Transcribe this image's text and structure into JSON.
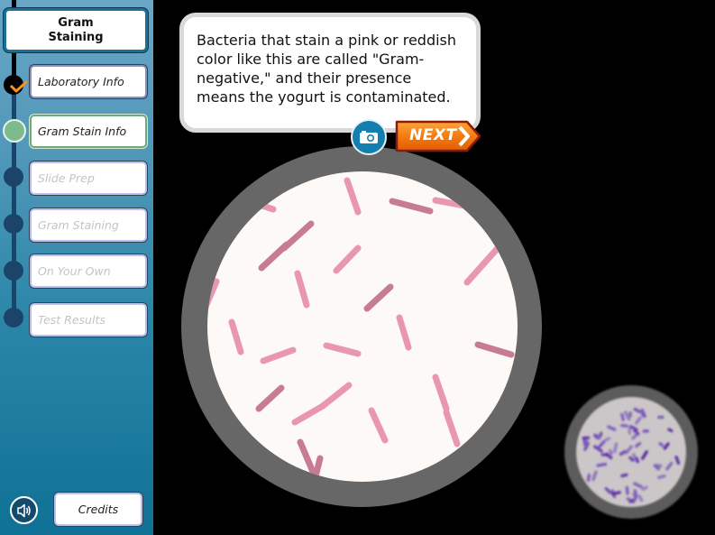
{
  "sidebar": {
    "title": "Gram\nStaining",
    "items": [
      {
        "label": "Laboratory Info",
        "state": "done"
      },
      {
        "label": "Gram Stain Info",
        "state": "current"
      },
      {
        "label": "Slide Prep",
        "state": "locked"
      },
      {
        "label": "Gram Staining",
        "state": "locked"
      },
      {
        "label": "On Your Own",
        "state": "locked"
      },
      {
        "label": "Test Results",
        "state": "locked"
      }
    ],
    "credits_label": "Credits",
    "sound_icon": "speaker-icon"
  },
  "dialog": {
    "text": "Bacteria that stain a pink or reddish color like this are called \"Gram-negative,\" and their presence means the yogurt is contaminated.",
    "camera_icon": "camera-icon",
    "next_label": "NEXT"
  },
  "colors": {
    "gram_negative_light": "#e996b2",
    "gram_negative_dark": "#c87b95",
    "slide_background": "#fdf9f6",
    "lens_ring": "#676767",
    "gram_positive": "#5b2fa6",
    "next_orange": "#f2700a",
    "accent_blue": "#137fae"
  },
  "microscope_view": {
    "stain_result": "Gram-negative (pink rods)"
  },
  "mini_slide": {
    "stain_result": "Gram-positive (purple)"
  }
}
